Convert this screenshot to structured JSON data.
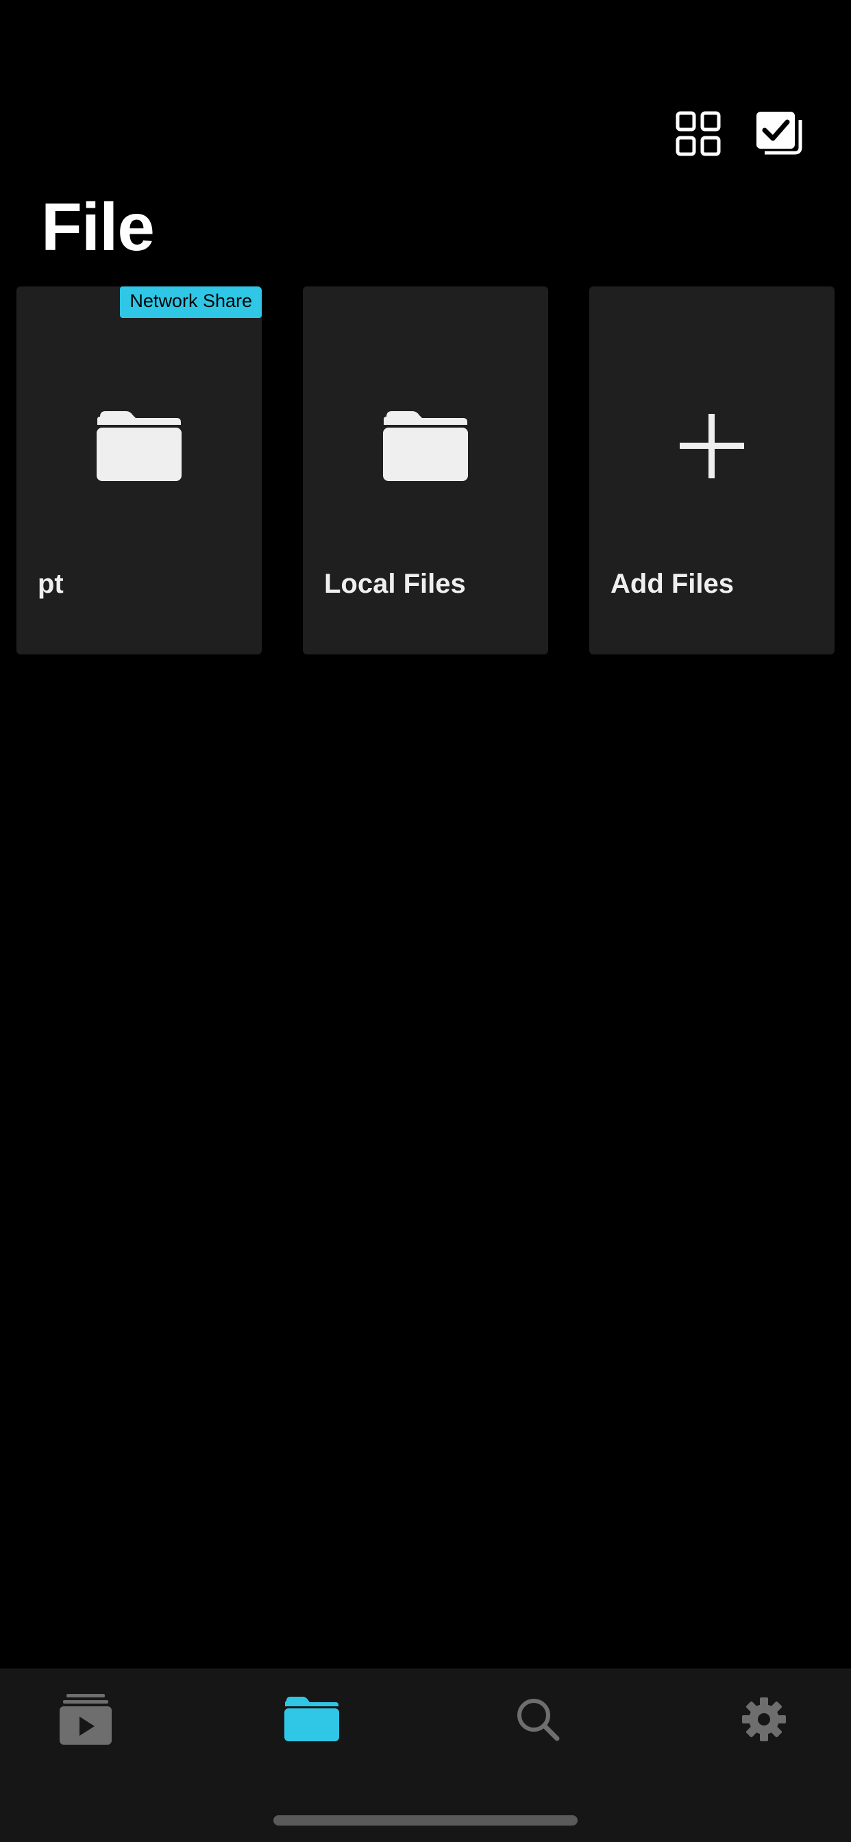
{
  "header": {
    "title": "File"
  },
  "toolbar": {
    "grid_icon": "grid-view-icon",
    "select_icon": "multi-select-checkbox-icon"
  },
  "tiles": [
    {
      "label": "pt",
      "badge": "Network Share",
      "icon": "folder-icon"
    },
    {
      "label": "Local Files",
      "badge": "",
      "icon": "folder-icon"
    },
    {
      "label": "Add Files",
      "badge": "",
      "icon": "plus-icon"
    }
  ],
  "tab_bar": {
    "items": [
      {
        "name": "media",
        "icon": "media-library-icon",
        "active": false
      },
      {
        "name": "files",
        "icon": "folder-icon",
        "active": true
      },
      {
        "name": "search",
        "icon": "search-icon",
        "active": false
      },
      {
        "name": "settings",
        "icon": "gear-icon",
        "active": false
      }
    ]
  },
  "colors": {
    "background": "#000000",
    "tile": "#1f1f1f",
    "accent": "#30c7e6",
    "tab_bar": "#161616",
    "inactive_icon": "#6e6e6e"
  }
}
